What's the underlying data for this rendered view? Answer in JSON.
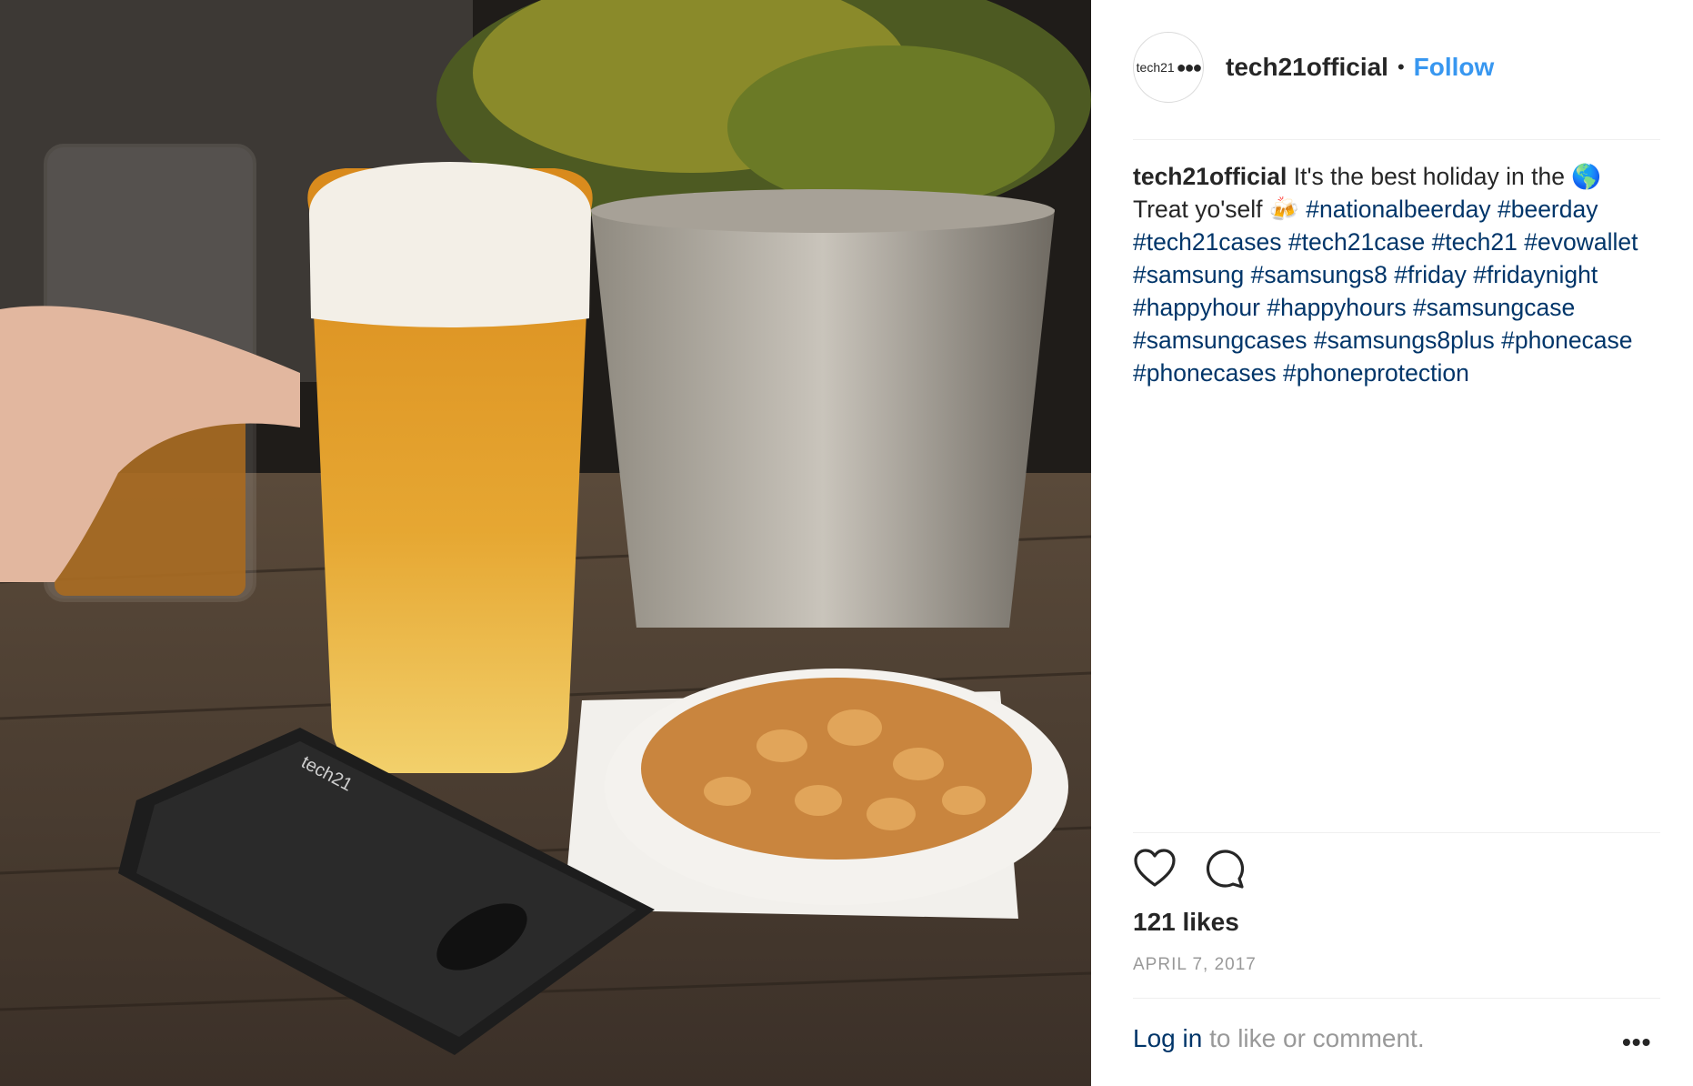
{
  "post": {
    "username": "tech21official",
    "separator": "•",
    "follow_label": "Follow",
    "avatar_text": "tech21",
    "avatar_dots": "●●●"
  },
  "caption": {
    "username": "tech21official",
    "text_1": " It's the best holiday in the ",
    "emoji_globe": "🌎",
    "text_2": " Treat yo'self ",
    "emoji_beer": "🍻",
    "hashtags": [
      "#nationalbeerday",
      "#beerday",
      "#tech21cases",
      "#tech21case",
      "#tech21",
      "#evowallet",
      "#samsung",
      "#samsungs8",
      "#friday",
      "#fridaynight",
      "#happyhour",
      "#happyhours",
      "#samsungcase",
      "#samsungcases",
      "#samsungs8plus",
      "#phonecase",
      "#phonecases",
      "#phoneprotection"
    ]
  },
  "engagement": {
    "likes": "121 likes",
    "date": "APRIL 7, 2017"
  },
  "footer": {
    "login_link": "Log in",
    "login_rest": " to like or comment.",
    "more_label": "•••"
  },
  "icons": {
    "like": "heart-icon",
    "comment": "comment-icon",
    "more": "more-options-icon"
  },
  "colors": {
    "link_blue": "#3897f0",
    "hashtag": "#003569",
    "text": "#262626",
    "muted": "#999999"
  }
}
